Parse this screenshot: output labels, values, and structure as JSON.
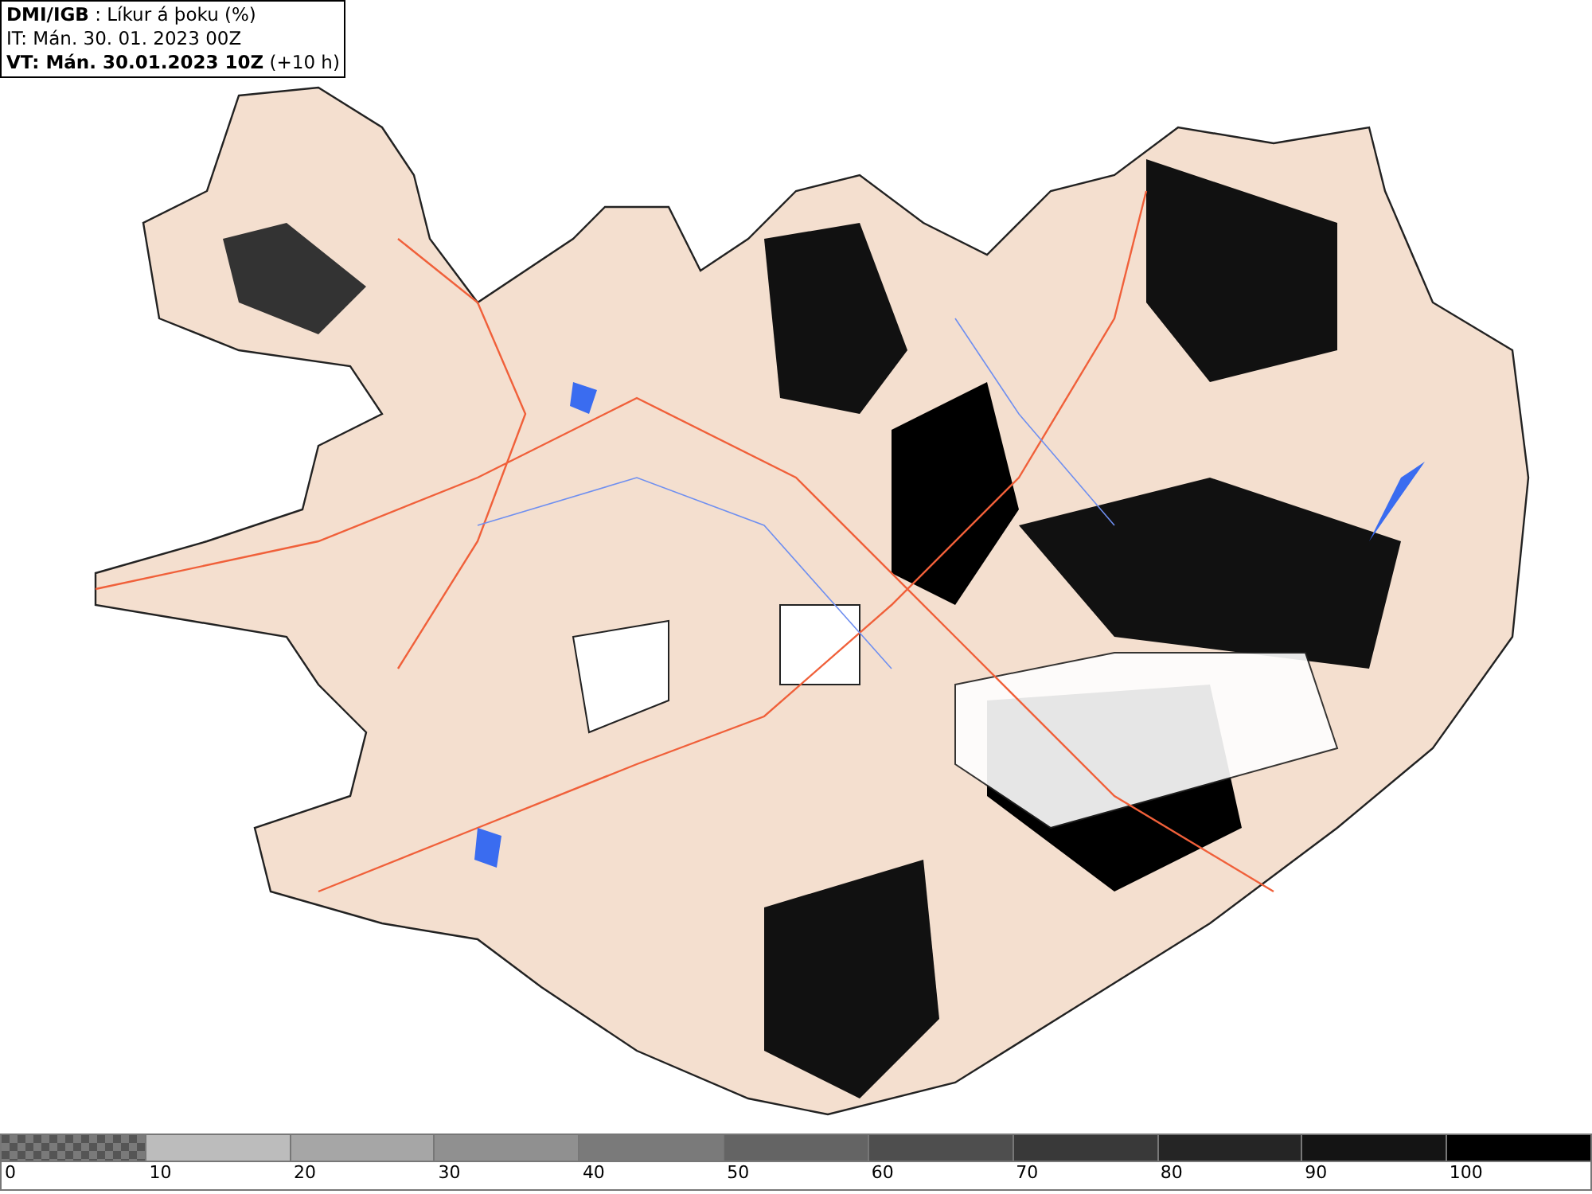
{
  "header": {
    "lines": [
      "**DMI/IGB** : Líkur á þoku (%)",
      "IT: Mán. 30. 01. 2023 00Z",
      "**VT: Mán. 30.01.2023 10Z** (+10 h)"
    ]
  },
  "legend": {
    "segments": [
      {
        "kind": "checker",
        "color": "#7a7a7a"
      },
      {
        "kind": "solid",
        "color": "#bcbcbc"
      },
      {
        "kind": "solid",
        "color": "#a6a6a6"
      },
      {
        "kind": "solid",
        "color": "#909090"
      },
      {
        "kind": "solid",
        "color": "#7a7a7a"
      },
      {
        "kind": "solid",
        "color": "#646464"
      },
      {
        "kind": "solid",
        "color": "#4e4e4e"
      },
      {
        "kind": "solid",
        "color": "#393939"
      },
      {
        "kind": "solid",
        "color": "#252525"
      },
      {
        "kind": "solid",
        "color": "#141414"
      },
      {
        "kind": "solid",
        "color": "#000000"
      }
    ],
    "ticks": [
      "0",
      "10",
      "20",
      "30",
      "40",
      "50",
      "60",
      "70",
      "80",
      "90",
      "100"
    ]
  }
}
